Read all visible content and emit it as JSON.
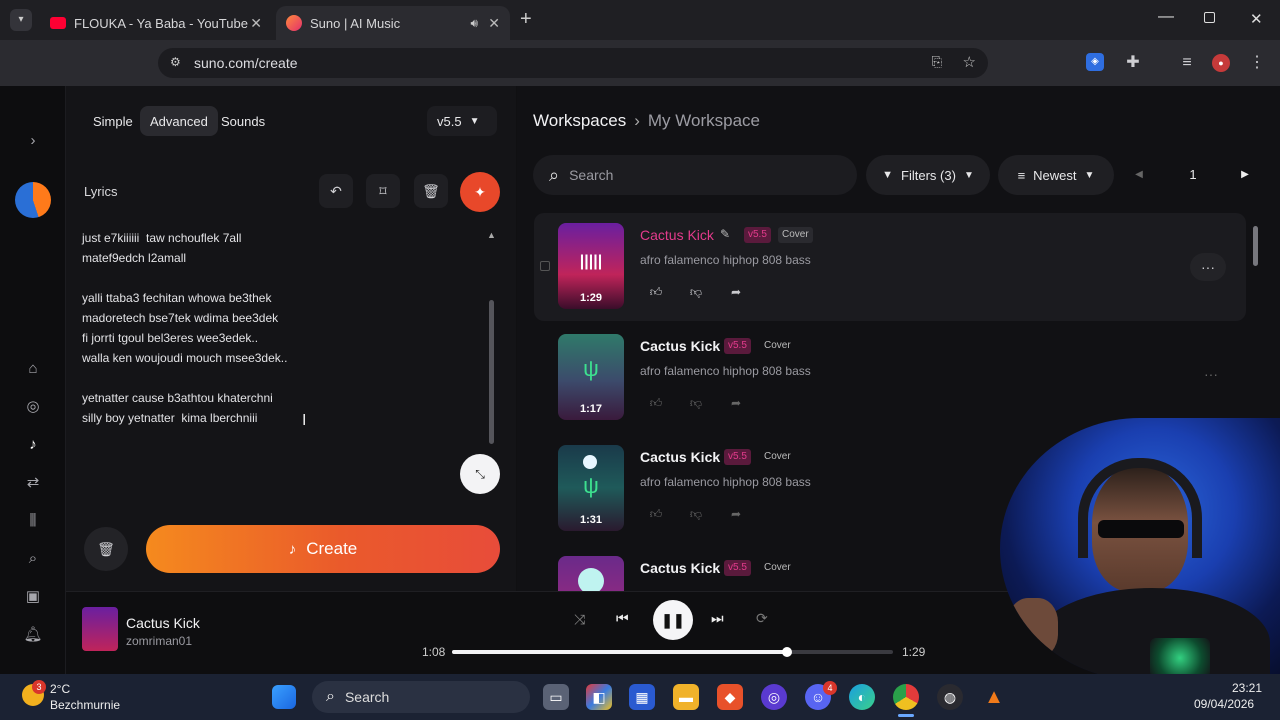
{
  "browser": {
    "tabs": [
      {
        "title": "FLOUKA - Ya Baba - YouTube",
        "icon": "youtube-icon"
      },
      {
        "title": "Suno | AI Music",
        "icon": "suno-icon"
      }
    ],
    "new_tab": "+",
    "url": "suno.com/create"
  },
  "modes": {
    "simple": "Simple",
    "advanced": "Advanced",
    "sounds": "Sounds",
    "version": "v5.5"
  },
  "lyrics": {
    "label": "Lyrics",
    "lines": [
      "just e7kiiiiii  taw nchouflek 7all",
      "matef9edch l2amall",
      "",
      "yalli ttaba3 fechitan whowa be3thek",
      "madoretech bse7tek wdima bee3dek",
      "fi jorrti tgoul bel3eres wee3edek..",
      "walla ken woujoudi mouch msee3dek..",
      "",
      "yetnatter cause b3athtou khaterchni",
      "silly boy yetnatter  kima lberchniii"
    ]
  },
  "create_button": "Create",
  "workspace": {
    "breadcrumb_root": "Workspaces",
    "breadcrumb_current": "My Workspace",
    "search_placeholder": "Search",
    "filters": "Filters (3)",
    "sort": "Newest",
    "page": "1"
  },
  "songs": [
    {
      "title": "Cactus Kick",
      "version": "v5.5",
      "tag": "Cover",
      "style": "afro falamenco hiphop 808 bass",
      "duration": "1:29",
      "active": true
    },
    {
      "title": "Cactus Kick",
      "version": "v5.5",
      "tag": "Cover",
      "style": "afro falamenco hiphop 808 bass",
      "duration": "1:17",
      "active": false
    },
    {
      "title": "Cactus Kick",
      "version": "v5.5",
      "tag": "Cover",
      "style": "afro falamenco hiphop 808 bass",
      "duration": "1:31",
      "active": false
    },
    {
      "title": "Cactus Kick",
      "version": "v5.5",
      "tag": "Cover",
      "style": "",
      "duration": "",
      "active": false
    }
  ],
  "player": {
    "title": "Cactus Kick",
    "artist": "zomriman01",
    "elapsed": "1:08",
    "total": "1:29",
    "progress": 0.76
  },
  "taskbar": {
    "weather_temp": "2°C",
    "weather_loc": "Bezchmurnie",
    "weather_badge": "3",
    "search": "Search",
    "discord_badge": "4",
    "time": "23:21",
    "date": "09/04/2026"
  },
  "colors": {
    "accent": "#e8482a",
    "pink": "#e33b8c",
    "badge_bg": "#5a1a3c"
  }
}
